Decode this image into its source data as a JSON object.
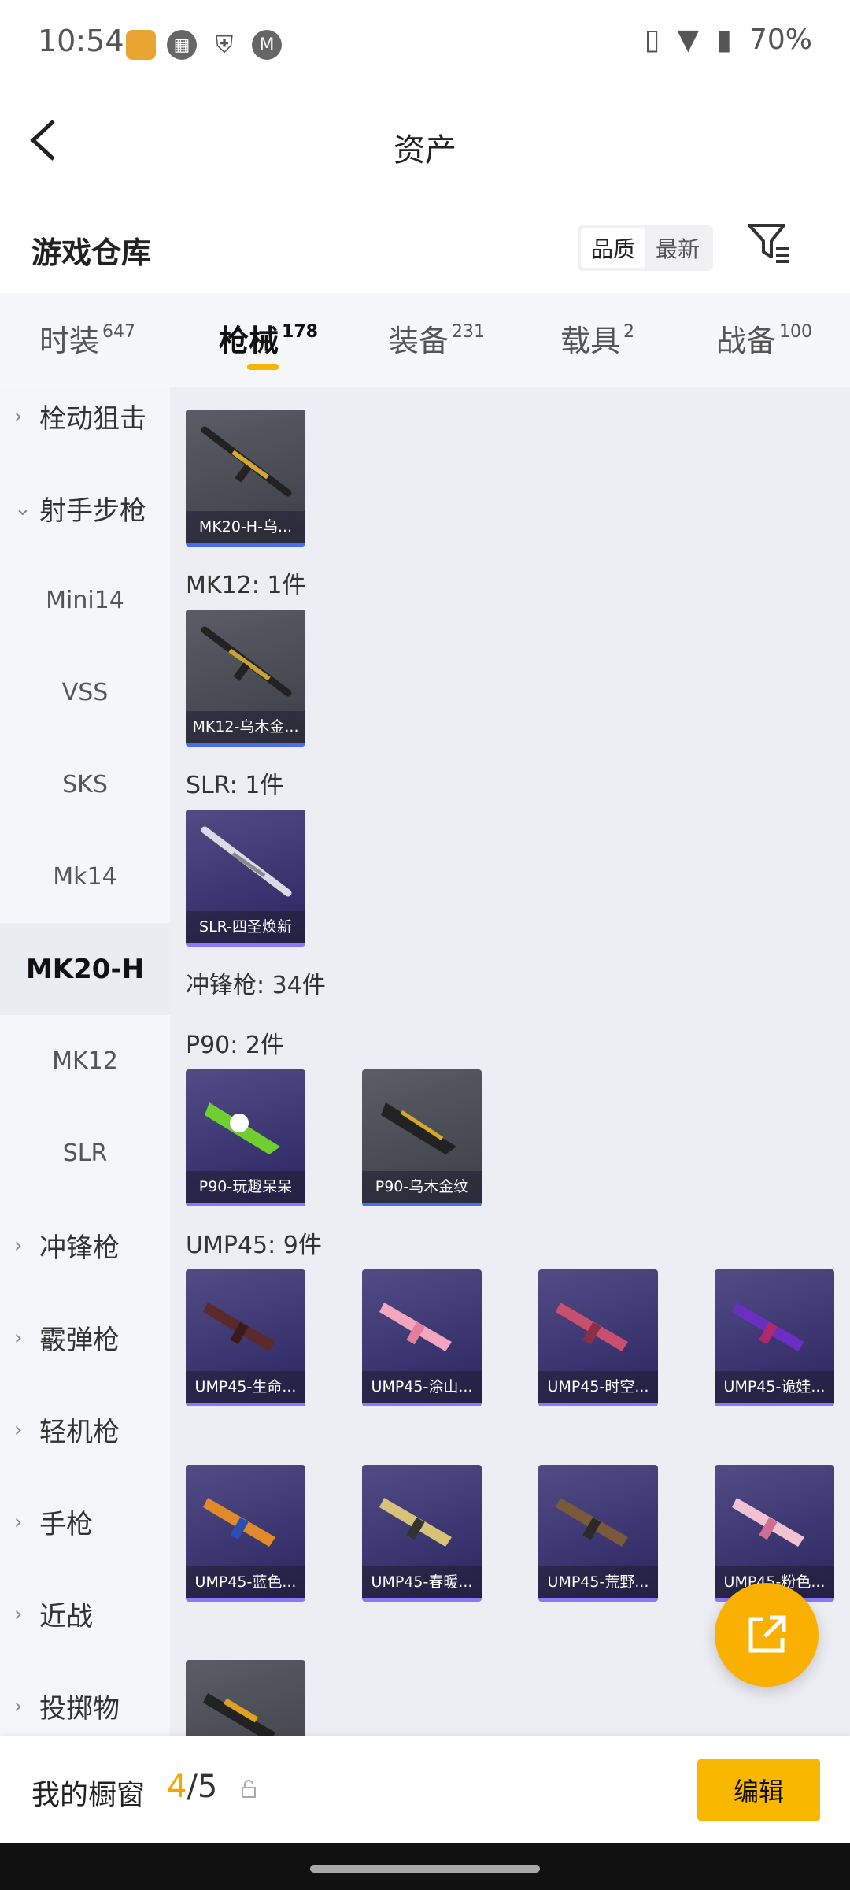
{
  "status": {
    "time": "10:54",
    "battery": "70%"
  },
  "header": {
    "title": "资产"
  },
  "section": {
    "title": "游戏仓库",
    "sort_quality": "品质",
    "sort_latest": "最新"
  },
  "tabs": [
    {
      "label": "时装",
      "count": "647"
    },
    {
      "label": "枪械",
      "count": "178",
      "active": true
    },
    {
      "label": "装备",
      "count": "231"
    },
    {
      "label": "载具",
      "count": "2"
    },
    {
      "label": "战备",
      "count": "100"
    }
  ],
  "sidebar": {
    "items": [
      {
        "label": "栓动狙击",
        "type": "category"
      },
      {
        "label": "射手步枪",
        "type": "category-open"
      },
      {
        "label": "Mini14",
        "type": "sub"
      },
      {
        "label": "VSS",
        "type": "sub"
      },
      {
        "label": "SKS",
        "type": "sub"
      },
      {
        "label": "Mk14",
        "type": "sub"
      },
      {
        "label": "MK20-H",
        "type": "sub-selected"
      },
      {
        "label": "MK12",
        "type": "sub"
      },
      {
        "label": "SLR",
        "type": "sub"
      },
      {
        "label": "冲锋枪",
        "type": "category"
      },
      {
        "label": "霰弹枪",
        "type": "category"
      },
      {
        "label": "轻机枪",
        "type": "category"
      },
      {
        "label": "手枪",
        "type": "category"
      },
      {
        "label": "近战",
        "type": "category"
      },
      {
        "label": "投掷物",
        "type": "category"
      }
    ]
  },
  "content": {
    "group_mk12": "MK12: 1件",
    "group_slr": "SLR: 1件",
    "group_smg": "冲锋枪: 34件",
    "group_p90": "P90: 2件",
    "group_ump45": "UMP45: 9件",
    "cards": {
      "mk20": "MK20-H-乌...",
      "mk12": "MK12-乌木金...",
      "slr": "SLR-四圣焕新",
      "p90_1": "P90-玩趣呆呆",
      "p90_2": "P90-乌木金纹",
      "ump_1": "UMP45-生命...",
      "ump_2": "UMP45-涂山...",
      "ump_3": "UMP45-时空...",
      "ump_4": "UMP45-诡娃...",
      "ump_5": "UMP45-蓝色...",
      "ump_6": "UMP45-春暖...",
      "ump_7": "UMP45-荒野...",
      "ump_8": "UMP45-粉色..."
    }
  },
  "bottom": {
    "shelf_label": "我的橱窗",
    "shelf_current": "4",
    "shelf_total": "/5",
    "edit_label": "编辑"
  }
}
